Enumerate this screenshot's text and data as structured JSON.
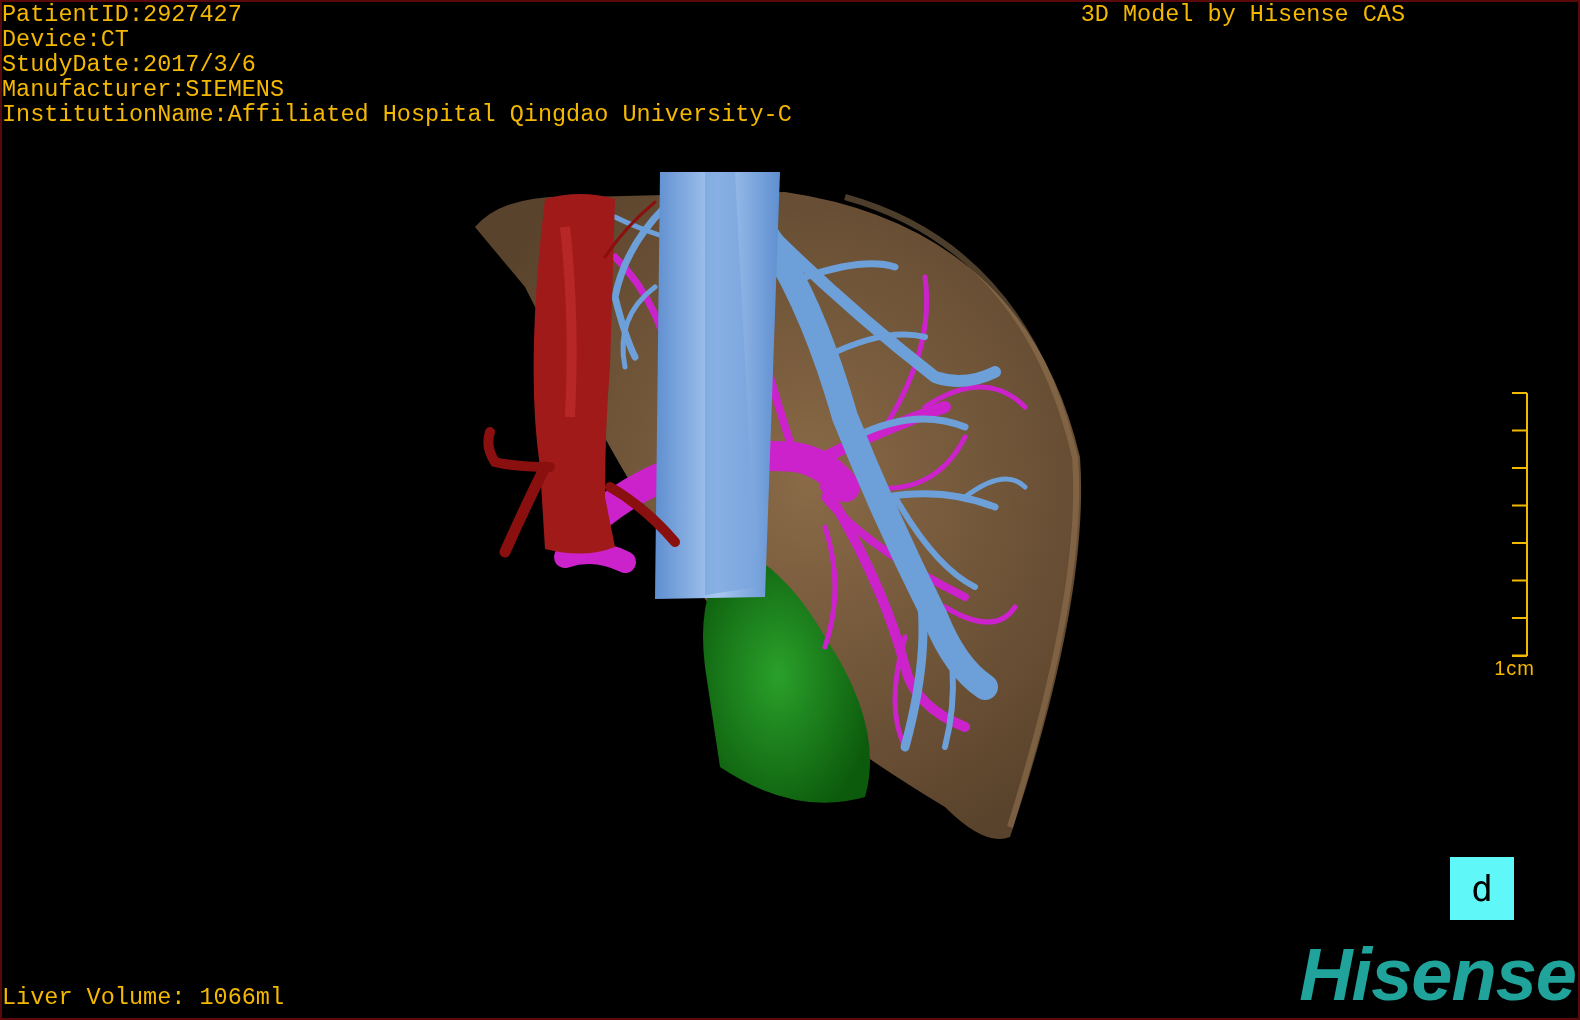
{
  "info_lines": [
    "PatientID:2927427",
    "Device:CT",
    "StudyDate:2017/3/6",
    "Manufacturer:SIEMENS",
    "InstitutionName:Affiliated Hospital Qingdao University-C"
  ],
  "title": "3D Model by Hisense CAS",
  "scale_bar": {
    "label": "1cm"
  },
  "orientation_cube": {
    "label": "d"
  },
  "logo": "Hisense",
  "liver_volume": "Liver Volume: 1066ml"
}
